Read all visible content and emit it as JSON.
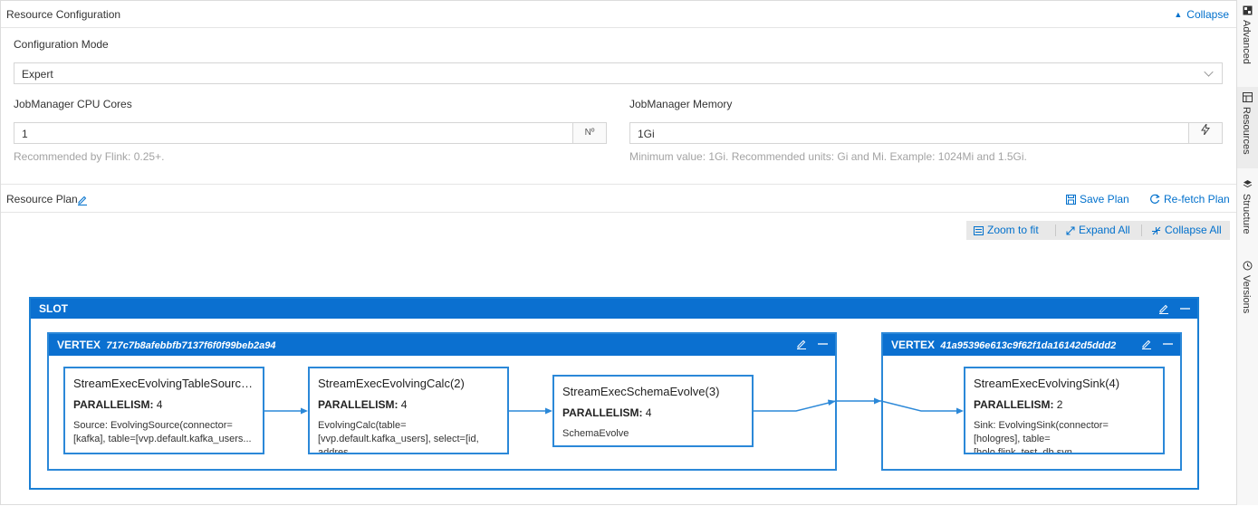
{
  "header": {
    "title": "Resource Configuration",
    "collapse_label": "Collapse"
  },
  "config": {
    "mode_label": "Configuration Mode",
    "mode_value": "Expert",
    "cpu_label": "JobManager CPU Cores",
    "cpu_value": "1",
    "cpu_addon": "Nº",
    "cpu_help": "Recommended by Flink: 0.25+.",
    "memory_label": "JobManager Memory",
    "memory_value": "1Gi",
    "memory_help": "Minimum value: 1Gi. Recommended units: Gi and Mi. Example: 1024Mi and 1.5Gi."
  },
  "plan": {
    "title": "Resource Plan",
    "save_label": "Save Plan",
    "refetch_label": "Re-fetch Plan",
    "zoom_label": "Zoom to fit",
    "expand_label": "Expand All",
    "collapse_all_label": "Collapse All"
  },
  "slot": {
    "title": "SLOT",
    "vertices": [
      {
        "label": "VERTEX",
        "id": "717c7b8afebbfb7137f6f0f99beb2a94",
        "operators": [
          {
            "name": "StreamExecEvolvingTableSource...",
            "parallelism_label": "PARALLELISM:",
            "parallelism": "4",
            "desc": "Source: EvolvingSource(connector=[kafka], table=[vvp.default.kafka_users..."
          },
          {
            "name": "StreamExecEvolvingCalc(2)",
            "parallelism_label": "PARALLELISM:",
            "parallelism": "4",
            "desc": "EvolvingCalc(table=[vvp.default.kafka_users], select=[id, addres..."
          },
          {
            "name": "StreamExecSchemaEvolve(3)",
            "parallelism_label": "PARALLELISM:",
            "parallelism": "4",
            "desc": "SchemaEvolve"
          }
        ]
      },
      {
        "label": "VERTEX",
        "id": "41a95396e613c9f62f1da16142d5ddd2",
        "operators": [
          {
            "name": "StreamExecEvolvingSink(4)",
            "parallelism_label": "PARALLELISM:",
            "parallelism": "2",
            "desc": "Sink: EvolvingSink(connector=[hologres], table=[holo.flink_test_db.syn..."
          }
        ]
      }
    ]
  },
  "right_rail": {
    "tabs": [
      "Advanced",
      "Resources",
      "Structure",
      "Versions"
    ]
  },
  "colors": {
    "accent": "#0070cc",
    "slot_header": "#0b70d0",
    "border_blue": "#2b88d8"
  },
  "icons": [
    "caret-up-icon",
    "edit-icon",
    "save-icon",
    "refresh-icon",
    "zoom-fit-icon",
    "expand-icon",
    "collapse-icon",
    "minus-icon",
    "chevron-down-icon",
    "lightning-icon"
  ]
}
